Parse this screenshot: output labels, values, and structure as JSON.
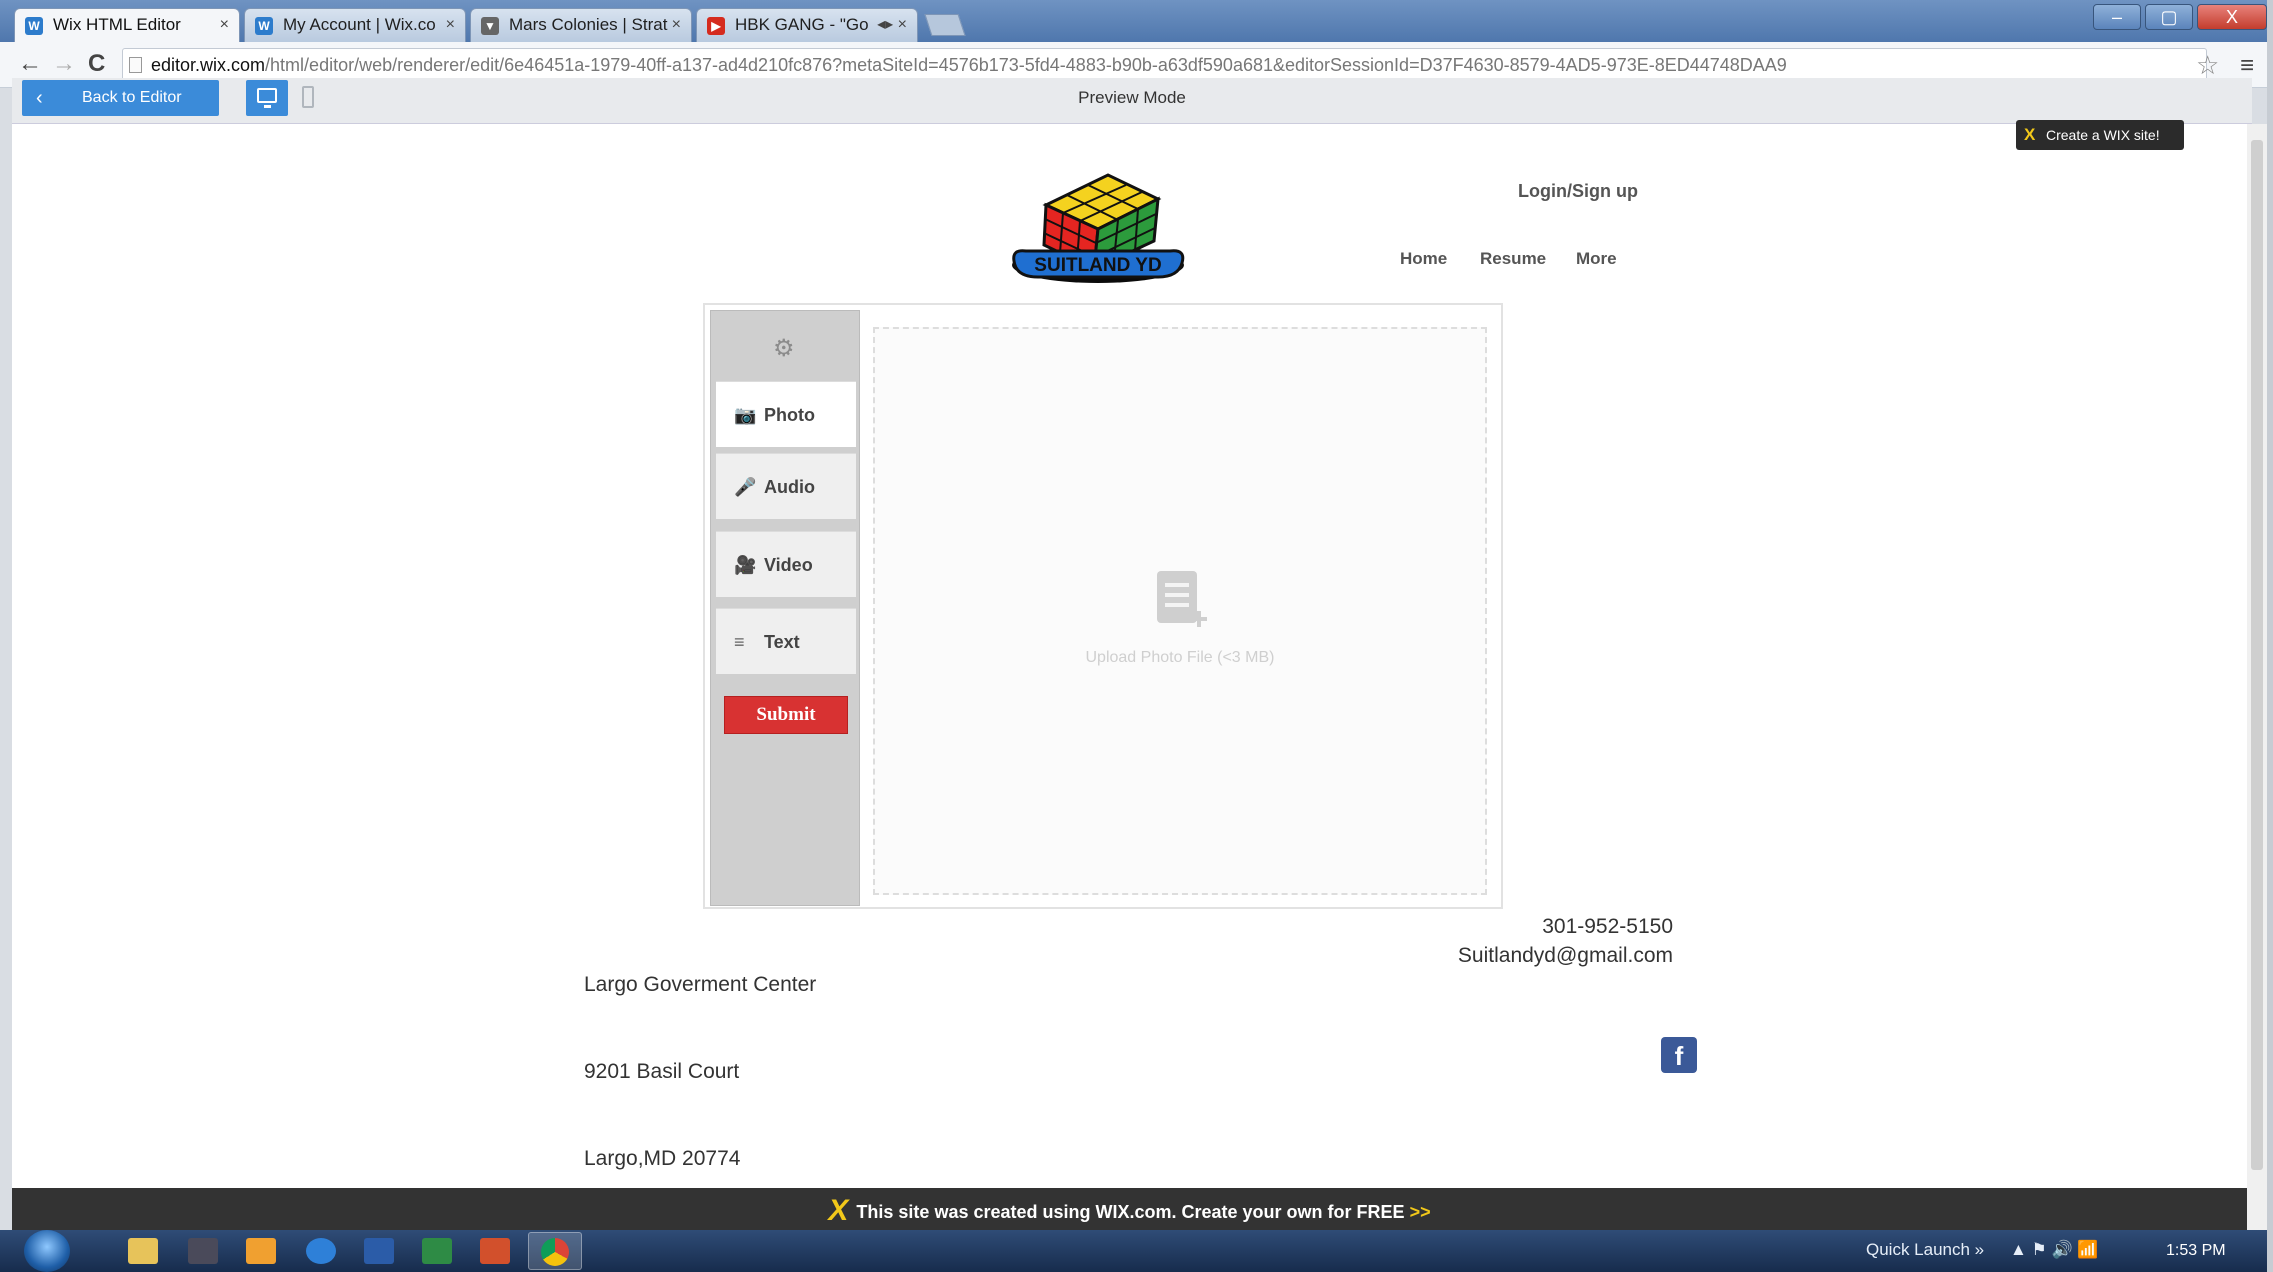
{
  "browser": {
    "tabs": [
      {
        "label": "Wix HTML Editor",
        "close": "×",
        "favicon": "wix-icon"
      },
      {
        "label": "My Account | Wix.co",
        "close": "×",
        "favicon": "wix-icon"
      },
      {
        "label": "Mars Colonies | Strat",
        "close": "×",
        "favicon": "pin-icon"
      },
      {
        "label": "HBK GANG - \"Go",
        "close": "◂▸ ×",
        "favicon": "youtube-icon"
      }
    ],
    "url_host": "editor.wix.com",
    "url_path": "/html/editor/web/renderer/edit/6e46451a-1979-40ff-a137-ad4d210fc876?metaSiteId=4576b173-5fd4-4883-b90b-a63df590a681&editorSessionId=D37F4630-8579-4AD5-973E-8ED44748DAA9",
    "back_glyph": "←",
    "forward_glyph": "→",
    "reload_glyph": "C",
    "star_glyph": "☆",
    "menu_glyph": "≡",
    "window_buttons": [
      "–",
      "▢",
      "X"
    ]
  },
  "preview_bar": {
    "back_label": "Back to Editor",
    "back_glyph": "‹",
    "mode_label": "Preview Mode"
  },
  "site": {
    "create_wix": "Create a WIX site!",
    "create_wix_glyph": "X",
    "logo_text": "SUITLAND YD",
    "login": "Login/Sign up",
    "nav": [
      "Home",
      "Resume",
      "More"
    ],
    "widget": {
      "gear_glyph": "⚙",
      "tabs": [
        {
          "label": "Photo",
          "icon": "camera-icon",
          "glyph": "📷"
        },
        {
          "label": "Audio",
          "icon": "microphone-icon",
          "glyph": "🎤"
        },
        {
          "label": "Video",
          "icon": "video-camera-icon",
          "glyph": "🎥"
        },
        {
          "label": "Text",
          "icon": "text-lines-icon",
          "glyph": "≡"
        }
      ],
      "submit": "Submit",
      "upload_text": "Upload Photo File (<3 MB)"
    },
    "address": [
      "Largo Goverment Center",
      "9201 Basil Court",
      "Largo,MD 20774"
    ],
    "phone": "301-952-5150",
    "email": "Suitlandyd@gmail.com",
    "facebook_glyph": "f"
  },
  "wix_banner": {
    "logo_glyph": "X",
    "text": "This site was created using WIX.com. Create your own for FREE",
    "arrow": ">>"
  },
  "taskbar": {
    "quick_launch": "Quick Launch »",
    "tray_glyphs": "▲  ⚑  🔊  📶",
    "clock": "1:53 PM"
  },
  "colors": {
    "accent_blue": "#3b8bd9",
    "submit_red": "#d83232",
    "facebook": "#3b5998",
    "wix_yellow": "#f2c81a"
  }
}
